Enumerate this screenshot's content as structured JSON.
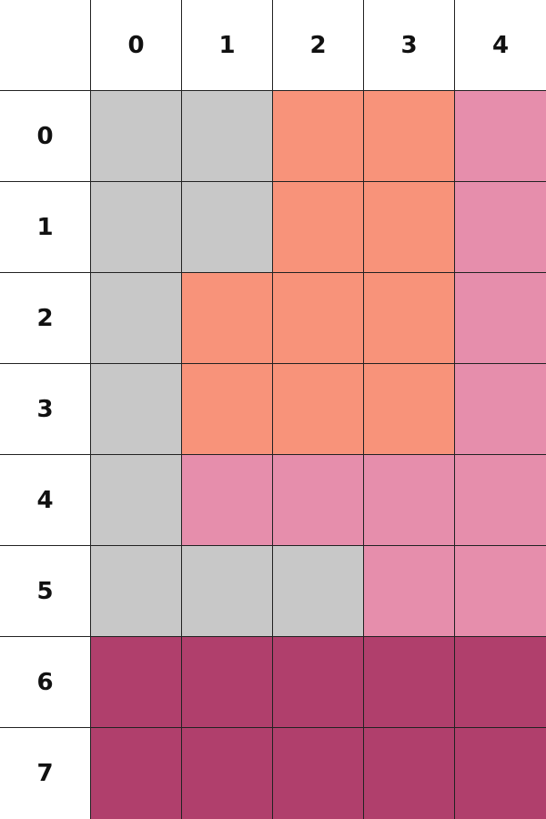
{
  "column_headers": [
    "0",
    "1",
    "2",
    "3",
    "4"
  ],
  "row_labels": [
    "0",
    "1",
    "2",
    "3",
    "4",
    "5",
    "6",
    "7"
  ],
  "palette": {
    "gray": "#c8c8c8",
    "salmon": "#f8937a",
    "pink": "#e68eac",
    "magenta": "#b03f6c"
  },
  "cells": [
    [
      "gray",
      "gray",
      "salmon",
      "salmon",
      "pink"
    ],
    [
      "gray",
      "gray",
      "salmon",
      "salmon",
      "pink"
    ],
    [
      "gray",
      "salmon",
      "salmon",
      "salmon",
      "pink"
    ],
    [
      "gray",
      "salmon",
      "salmon",
      "salmon",
      "pink"
    ],
    [
      "gray",
      "pink",
      "pink",
      "pink",
      "pink"
    ],
    [
      "gray",
      "gray",
      "gray",
      "pink",
      "pink"
    ],
    [
      "magenta",
      "magenta",
      "magenta",
      "magenta",
      "magenta"
    ],
    [
      "magenta",
      "magenta",
      "magenta",
      "magenta",
      "magenta"
    ]
  ]
}
